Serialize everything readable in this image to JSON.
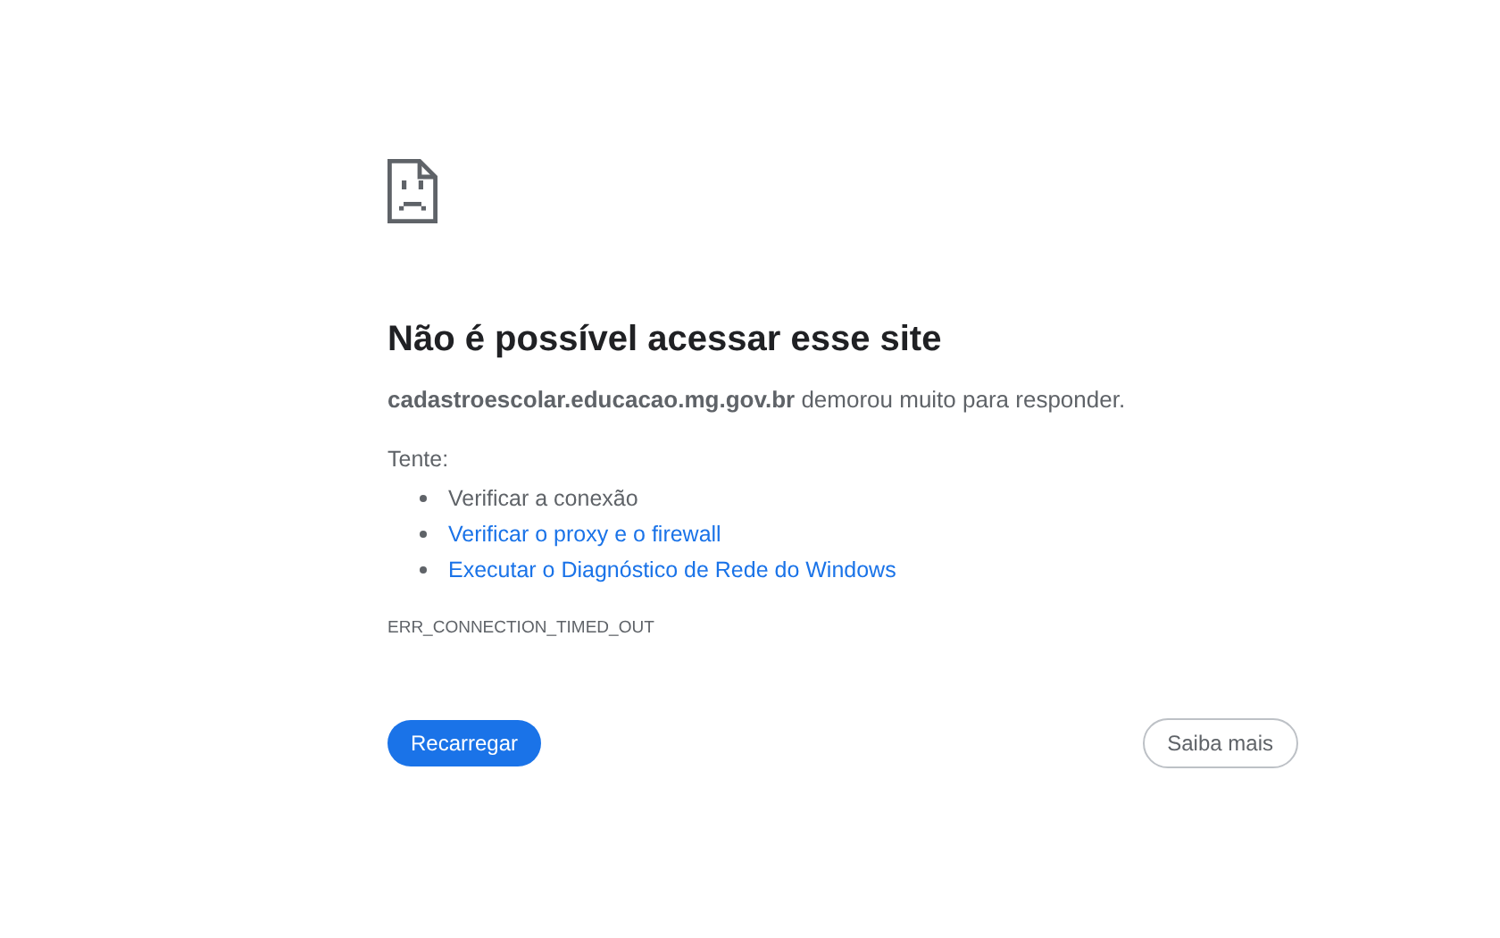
{
  "error_page": {
    "title": "Não é possível acessar esse site",
    "message": "**cadastroescolar.educacao.mg.gov.br** demorou muito para responder.",
    "suggestions_heading": "Tente:",
    "suggestions": [
      {
        "kind": "text",
        "label": "Verificar a conexão"
      },
      {
        "kind": "link",
        "label": "Verificar o proxy e o firewall"
      },
      {
        "kind": "link",
        "label": "Executar o Diagnóstico de Rede do Windows"
      }
    ],
    "error_code": "ERR_CONNECTION_TIMED_OUT",
    "buttons": [
      {
        "kind": "primary",
        "label": "Recarregar"
      },
      {
        "kind": "secondary",
        "label": "Saiba mais"
      }
    ]
  }
}
